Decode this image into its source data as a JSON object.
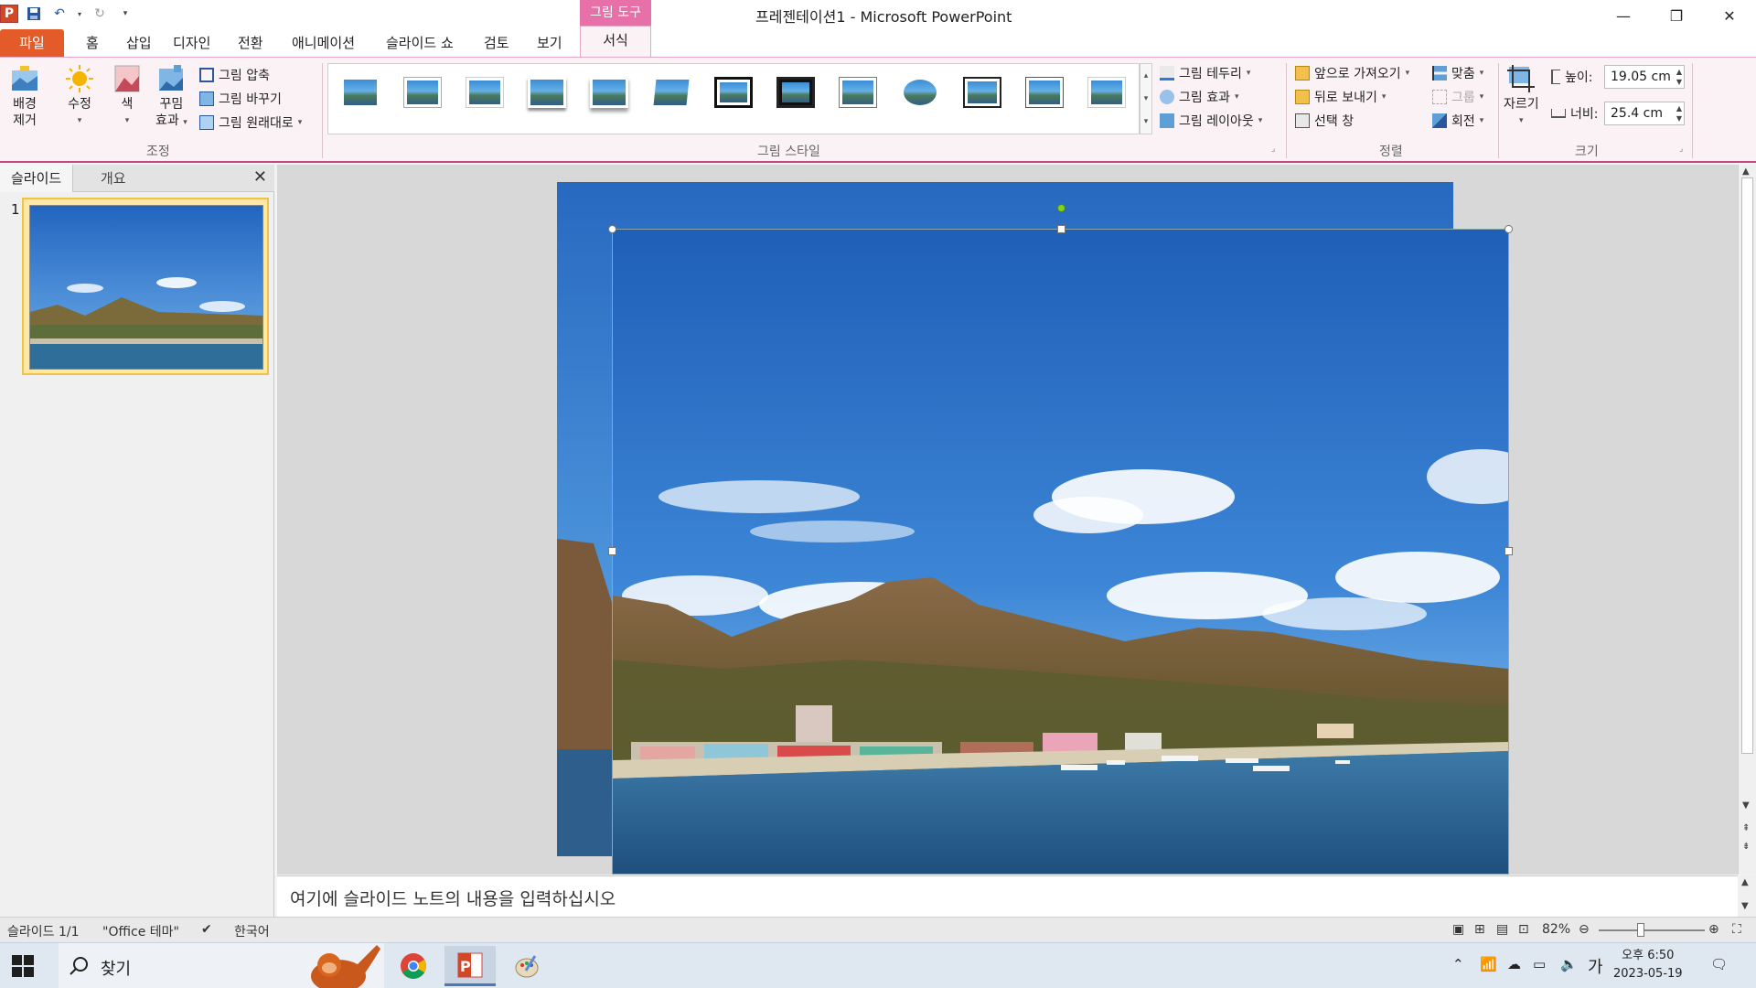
{
  "window": {
    "title": "프레젠테이션1 - Microsoft PowerPoint",
    "app_icon": "P"
  },
  "tabs": {
    "file": "파일",
    "home": "홈",
    "insert": "삽입",
    "design": "디자인",
    "transitions": "전환",
    "animations": "애니메이션",
    "slideshow": "슬라이드 쇼",
    "review": "검토",
    "view": "보기",
    "context_group": "그림 도구",
    "format": "서식"
  },
  "ribbon": {
    "adjust": {
      "label": "조정",
      "remove_bg_1": "배경",
      "remove_bg_2": "제거",
      "corrections": "수정",
      "color": "색",
      "artistic_1": "꾸밈",
      "artistic_2": "효과",
      "compress": "그림 압축",
      "change": "그림 바꾸기",
      "reset": "그림 원래대로"
    },
    "styles": {
      "label": "그림 스타일",
      "border": "그림 테두리",
      "effects": "그림 효과",
      "layout": "그림 레이아웃"
    },
    "arrange": {
      "label": "정렬",
      "bring_forward": "앞으로 가져오기",
      "send_backward": "뒤로 보내기",
      "selection_pane": "선택 창",
      "align": "맞춤",
      "group": "그룹",
      "rotate": "회전"
    },
    "size": {
      "label": "크기",
      "crop": "자르기",
      "height_label": "높이:",
      "height_value": "19.05 cm",
      "width_label": "너비:",
      "width_value": "25.4 cm"
    }
  },
  "panel": {
    "tab_slides": "슬라이드",
    "tab_outline": "개요",
    "slide_number": "1"
  },
  "notes": {
    "placeholder": "여기에 슬라이드 노트의 내용을 입력하십시오"
  },
  "status": {
    "slide": "슬라이드 1/1",
    "theme": "\"Office 테마\"",
    "language": "한국어",
    "zoom": "82%"
  },
  "taskbar": {
    "search": "찾기",
    "ime": "가",
    "time": "오후 6:50",
    "date": "2023-05-19"
  },
  "colors": {
    "accent_file_tab": "#e45b2a",
    "context_tab": "#e770a8",
    "ribbon_bg": "#fbf2f6",
    "sky": "#2a6fc2"
  }
}
